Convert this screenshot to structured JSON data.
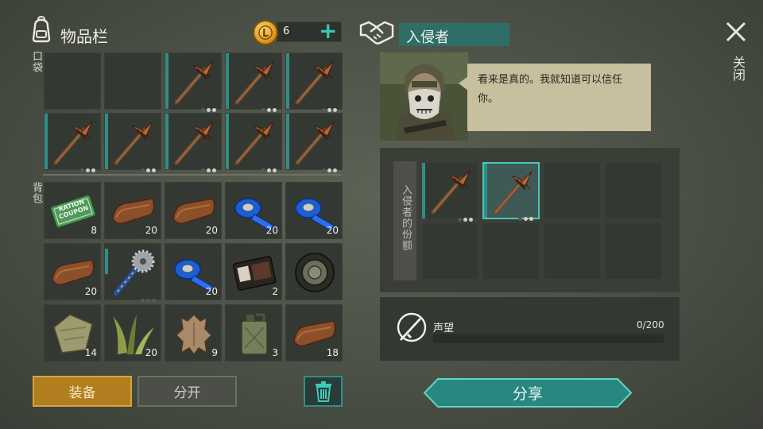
{
  "inventory": {
    "title": "物品栏",
    "coins": "6",
    "pocket_label": "口袋",
    "backpack_label": "背包"
  },
  "pocket_slots": [
    {
      "item": "empty"
    },
    {
      "item": "empty"
    },
    {
      "item": "pickaxe",
      "qty": ""
    },
    {
      "item": "pickaxe",
      "qty": ""
    },
    {
      "item": "pickaxe",
      "qty": ""
    },
    {
      "item": "pickaxe",
      "qty": ""
    },
    {
      "item": "pickaxe",
      "qty": ""
    },
    {
      "item": "pickaxe",
      "qty": ""
    },
    {
      "item": "pickaxe",
      "qty": ""
    },
    {
      "item": "pickaxe",
      "qty": ""
    }
  ],
  "backpack_slots": [
    {
      "item": "ration-coupon",
      "qty": "8",
      "label1": "RATION",
      "label2": "COUPON"
    },
    {
      "item": "leather",
      "qty": "20"
    },
    {
      "item": "leather",
      "qty": "20"
    },
    {
      "item": "blue-tape",
      "qty": "20"
    },
    {
      "item": "blue-tape",
      "qty": "20"
    },
    {
      "item": "leather",
      "qty": "20"
    },
    {
      "item": "saw-tool",
      "qty": ""
    },
    {
      "item": "blue-tape",
      "qty": "20"
    },
    {
      "item": "wallet",
      "qty": "2"
    },
    {
      "item": "tire",
      "qty": ""
    },
    {
      "item": "cloth",
      "qty": "14"
    },
    {
      "item": "plant-fiber",
      "qty": "20"
    },
    {
      "item": "animal-hide",
      "qty": "9"
    },
    {
      "item": "jerrycan",
      "qty": "3"
    },
    {
      "item": "leather",
      "qty": "18"
    }
  ],
  "buttons": {
    "equip": "装备",
    "split": "分开",
    "share": "分享",
    "close": "关闭"
  },
  "npc": {
    "name": "入侵者",
    "dialog": "看来是真的。我就知道可以信任你。",
    "share_label": "入侵者的份额",
    "share_slots": [
      {
        "item": "pickaxe"
      },
      {
        "item": "pickaxe",
        "selected": true
      },
      {
        "item": "empty"
      },
      {
        "item": "empty"
      },
      {
        "item": "empty"
      },
      {
        "item": "empty"
      },
      {
        "item": "empty"
      },
      {
        "item": "empty"
      }
    ]
  },
  "reputation": {
    "label": "声望",
    "value": "0/200",
    "progress": 0
  },
  "colors": {
    "accent": "#2f8f86",
    "equip": "#b07e1f",
    "speech": "#c7bf9e"
  }
}
